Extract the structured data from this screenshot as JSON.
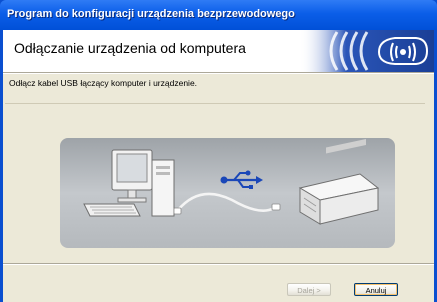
{
  "window": {
    "title": "Program do konfiguracji urządzenia bezprzewodowego"
  },
  "header": {
    "title": "Odłączanie urządzenia od komputera",
    "logo_icon": "wireless-signal-icon"
  },
  "main": {
    "instruction": "Odłącz kabel USB łączący komputer i urządzenie.",
    "illustration_icons": [
      "desktop-computer-icon",
      "usb-icon",
      "usb-cable-icon",
      "printer-icon"
    ]
  },
  "buttons": {
    "next_label": "Dalej >",
    "next_enabled": false,
    "cancel_label": "Anuluj"
  },
  "colors": {
    "titlebar": "#0b5ee8",
    "dialog_bg": "#ece9d8",
    "logo_blue": "#1a3f96",
    "usb_symbol": "#1a47b8"
  }
}
